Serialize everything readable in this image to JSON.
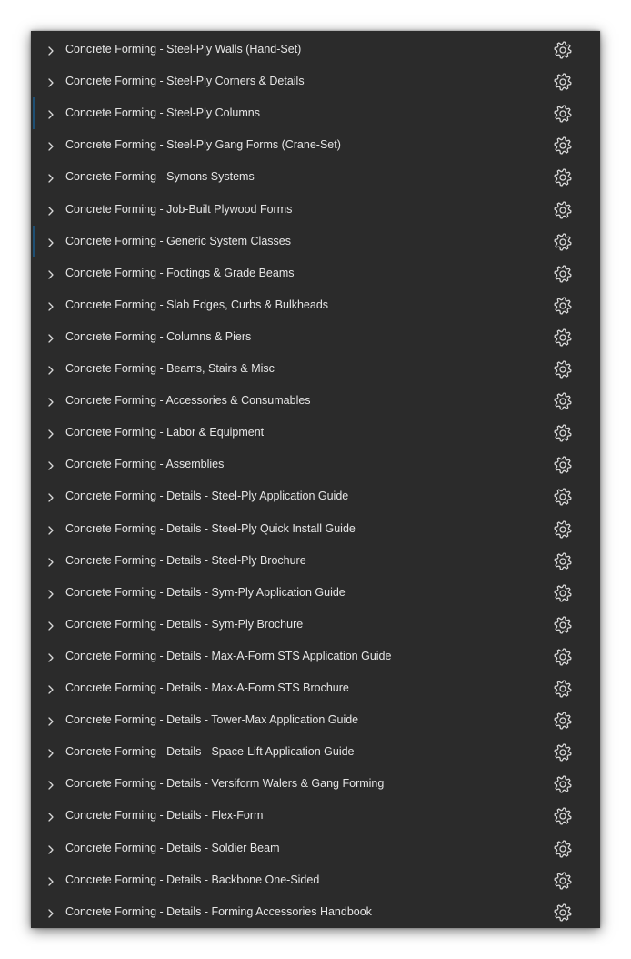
{
  "colors": {
    "panel_background": "#2b2b2b",
    "text": "#e6e6e6",
    "icon": "#d8d8d8",
    "selection_marker": "#1e4f73"
  },
  "list": {
    "items": [
      {
        "label": "Concrete Forming - Steel-Ply Walls (Hand-Set)",
        "expand_icon": "chevron-right-icon",
        "settings_icon": "gear-icon",
        "marked": false
      },
      {
        "label": "Concrete Forming - Steel-Ply Corners & Details",
        "expand_icon": "chevron-right-icon",
        "settings_icon": "gear-icon",
        "marked": false
      },
      {
        "label": "Concrete Forming - Steel-Ply Columns",
        "expand_icon": "chevron-right-icon",
        "settings_icon": "gear-icon",
        "marked": true
      },
      {
        "label": "Concrete Forming - Steel-Ply Gang Forms (Crane-Set)",
        "expand_icon": "chevron-right-icon",
        "settings_icon": "gear-icon",
        "marked": false
      },
      {
        "label": "Concrete Forming - Symons Systems",
        "expand_icon": "chevron-right-icon",
        "settings_icon": "gear-icon",
        "marked": false
      },
      {
        "label": "Concrete Forming - Job-Built Plywood Forms",
        "expand_icon": "chevron-right-icon",
        "settings_icon": "gear-icon",
        "marked": false
      },
      {
        "label": "Concrete Forming - Generic System Classes",
        "expand_icon": "chevron-right-icon",
        "settings_icon": "gear-icon",
        "marked": true
      },
      {
        "label": "Concrete Forming - Footings & Grade Beams",
        "expand_icon": "chevron-right-icon",
        "settings_icon": "gear-icon",
        "marked": false
      },
      {
        "label": "Concrete Forming - Slab Edges, Curbs & Bulkheads",
        "expand_icon": "chevron-right-icon",
        "settings_icon": "gear-icon",
        "marked": false
      },
      {
        "label": "Concrete Forming - Columns & Piers",
        "expand_icon": "chevron-right-icon",
        "settings_icon": "gear-icon",
        "marked": false
      },
      {
        "label": "Concrete Forming - Beams, Stairs & Misc",
        "expand_icon": "chevron-right-icon",
        "settings_icon": "gear-icon",
        "marked": false
      },
      {
        "label": "Concrete Forming - Accessories & Consumables",
        "expand_icon": "chevron-right-icon",
        "settings_icon": "gear-icon",
        "marked": false
      },
      {
        "label": "Concrete Forming - Labor & Equipment",
        "expand_icon": "chevron-right-icon",
        "settings_icon": "gear-icon",
        "marked": false
      },
      {
        "label": "Concrete Forming - Assemblies",
        "expand_icon": "chevron-right-icon",
        "settings_icon": "gear-icon",
        "marked": false
      },
      {
        "label": "Concrete Forming - Details - Steel-Ply Application Guide",
        "expand_icon": "chevron-right-icon",
        "settings_icon": "gear-icon",
        "marked": false
      },
      {
        "label": "Concrete Forming - Details - Steel-Ply Quick Install Guide",
        "expand_icon": "chevron-right-icon",
        "settings_icon": "gear-icon",
        "marked": false
      },
      {
        "label": "Concrete Forming - Details - Steel-Ply Brochure",
        "expand_icon": "chevron-right-icon",
        "settings_icon": "gear-icon",
        "marked": false
      },
      {
        "label": "Concrete Forming - Details - Sym-Ply Application Guide",
        "expand_icon": "chevron-right-icon",
        "settings_icon": "gear-icon",
        "marked": false
      },
      {
        "label": "Concrete Forming - Details - Sym-Ply Brochure",
        "expand_icon": "chevron-right-icon",
        "settings_icon": "gear-icon",
        "marked": false
      },
      {
        "label": "Concrete Forming - Details - Max-A-Form STS Application Guide",
        "expand_icon": "chevron-right-icon",
        "settings_icon": "gear-icon",
        "marked": false
      },
      {
        "label": "Concrete Forming - Details - Max-A-Form STS Brochure",
        "expand_icon": "chevron-right-icon",
        "settings_icon": "gear-icon",
        "marked": false
      },
      {
        "label": "Concrete Forming - Details - Tower-Max Application Guide",
        "expand_icon": "chevron-right-icon",
        "settings_icon": "gear-icon",
        "marked": false
      },
      {
        "label": "Concrete Forming - Details - Space-Lift Application Guide",
        "expand_icon": "chevron-right-icon",
        "settings_icon": "gear-icon",
        "marked": false
      },
      {
        "label": "Concrete Forming - Details - Versiform Walers & Gang Forming",
        "expand_icon": "chevron-right-icon",
        "settings_icon": "gear-icon",
        "marked": false
      },
      {
        "label": "Concrete Forming - Details - Flex-Form",
        "expand_icon": "chevron-right-icon",
        "settings_icon": "gear-icon",
        "marked": false
      },
      {
        "label": "Concrete Forming - Details - Soldier Beam",
        "expand_icon": "chevron-right-icon",
        "settings_icon": "gear-icon",
        "marked": false
      },
      {
        "label": "Concrete Forming - Details - Backbone One-Sided",
        "expand_icon": "chevron-right-icon",
        "settings_icon": "gear-icon",
        "marked": false
      },
      {
        "label": "Concrete Forming - Details - Forming Accessories Handbook",
        "expand_icon": "chevron-right-icon",
        "settings_icon": "gear-icon",
        "marked": false
      }
    ]
  }
}
